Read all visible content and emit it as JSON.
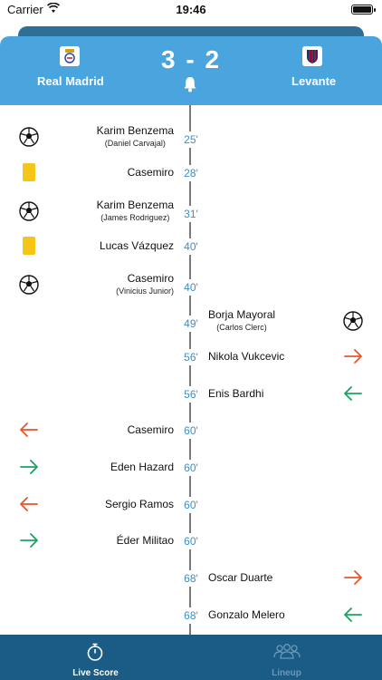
{
  "status_bar": {
    "carrier": "Carrier",
    "time": "19:46"
  },
  "match": {
    "home_team": "Real Madrid",
    "away_team": "Levante",
    "score": "3 - 2",
    "home_logo": "real-madrid-crest-icon",
    "away_logo": "levante-crest-icon"
  },
  "colors": {
    "header": "#4aa4de",
    "tabbar": "#1a5c86",
    "minute": "#3b8fc6",
    "sub_in": "#1aa260",
    "sub_out": "#e8562a",
    "yellow_card": "#f5c518"
  },
  "events": [
    {
      "side": "home",
      "type": "goal",
      "player": "Karim Benzema",
      "assist": "(Daniel Carvajal)",
      "minute": "25'"
    },
    {
      "side": "home",
      "type": "yellow-card",
      "player": "Casemiro",
      "assist": "",
      "minute": "28'"
    },
    {
      "side": "home",
      "type": "goal",
      "player": "Karim Benzema",
      "assist": "(James Rodriguez)",
      "minute": "31'"
    },
    {
      "side": "home",
      "type": "yellow-card",
      "player": "Lucas Vázquez",
      "assist": "",
      "minute": "40'"
    },
    {
      "side": "home",
      "type": "goal",
      "player": "Casemiro",
      "assist": "(Vinicius Junior)",
      "minute": "40'"
    },
    {
      "side": "away",
      "type": "goal",
      "player": "Borja Mayoral",
      "assist": "(Carlos Clerc)",
      "minute": "49'"
    },
    {
      "side": "away",
      "type": "sub-out",
      "player": "Nikola Vukcevic",
      "assist": "",
      "minute": "56'"
    },
    {
      "side": "away",
      "type": "sub-in",
      "player": "Enis Bardhi",
      "assist": "",
      "minute": "56'"
    },
    {
      "side": "home",
      "type": "sub-out",
      "player": "Casemiro",
      "assist": "",
      "minute": "60'"
    },
    {
      "side": "home",
      "type": "sub-in",
      "player": "Eden Hazard",
      "assist": "",
      "minute": "60'"
    },
    {
      "side": "home",
      "type": "sub-out",
      "player": "Sergio Ramos",
      "assist": "",
      "minute": "60'"
    },
    {
      "side": "home",
      "type": "sub-in",
      "player": "Éder Militao",
      "assist": "",
      "minute": "60'"
    },
    {
      "side": "away",
      "type": "sub-out",
      "player": "Oscar Duarte",
      "assist": "",
      "minute": "68'"
    },
    {
      "side": "away",
      "type": "sub-in",
      "player": "Gonzalo Melero",
      "assist": "",
      "minute": "68'"
    }
  ],
  "tabs": [
    {
      "label": "Live Score",
      "icon": "stopwatch-icon",
      "active": true
    },
    {
      "label": "Lineup",
      "icon": "people-icon",
      "active": false
    }
  ]
}
